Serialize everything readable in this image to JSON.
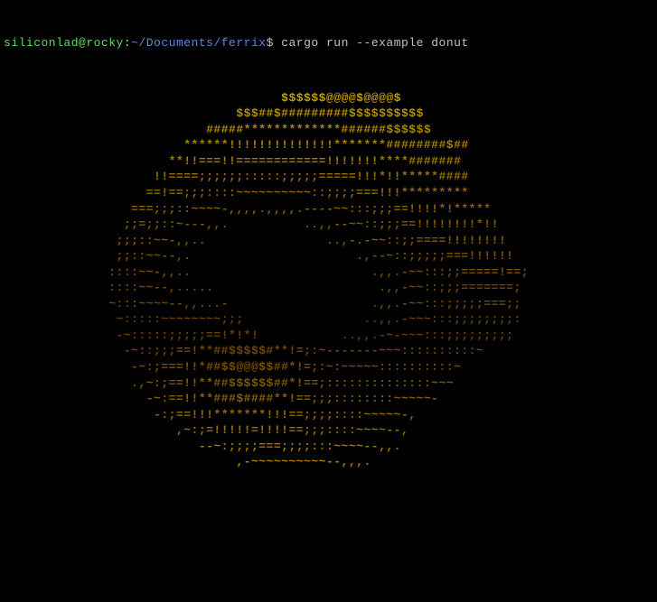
{
  "prompt": {
    "user_host": "siliconlad@rocky",
    "separator": ":",
    "path": "~/Documents/ferrix",
    "sigil": "$",
    "command": "cargo run --example donut"
  },
  "donut": {
    "lines": [
      "                                     $$$$$$@@@@$@@@@$",
      "                               $$$##$#########$$$$$$$$$$",
      "                           #####*************######$$$$$$",
      "                        ******!!!!!!!!!!!!!!*******########$##",
      "                      **!!===!!============!!!!!!!****#######",
      "                    !!====;;;;;;:::::;;;;;=====!!!*!!*****####",
      "                   ==!==;;;::::~~~~~~~~~~::;;;;===!!!*********",
      "                 ===;;;::~~~~-,,,,.,,,,.----~~:::;;;==!!!!*!*****",
      "                ;;=;;::~---,,.          ..,,--~~::;;;==!!!!!!!!*!!",
      "               ;;;::~~-,,..                ..,-.-~~::;;====!!!!!!!!",
      "               ;;::~~--,.                      .,--~::;;;;;===!!!!!!",
      "              ::::~~-,,..                        .,,.-~~:::;;=====!==;",
      "              ::::~~--,.....                      .,,-~~::;;;=======;",
      "              ~:::~~~~--,,...-                   .,,.-~~:::;;;;;===;;",
      "               ~:::::~~~~~~~~;;;                ..,,.-~~~:::;;;;;;;;:",
      "               -~:::::;;;;;==!*!*!           ..,,.-~-~~~:::;;;;;;;;;",
      "                -~::;;;==!**##$$$$$#**!=;:~-------~~~::::::::::~",
      "                 -~:;===!!*##$$@@@$$##*!=;:~:~~~~~::::::::::~",
      "                 .,~:;==!!**##$$$$$$##*!==;::::::::::::::~~~",
      "                   -~:==!!**###$####**!==;;;::::::::~~~~~-",
      "                    -:;==!!!*******!!!==;;;;::::~~~~~-,",
      "                       ,~:;=!!!!!=!!!!==;;;::::~~~~--,",
      "                          --~:;;;;===;;;;:::~~~~--,,.",
      "                               ,-~~~~~~~~~~--,,,."
    ],
    "colors": [
      "#c0a000",
      "#b89000",
      "#b08800",
      "#a88000",
      "#a07800",
      "#987000",
      "#906800",
      "#886000",
      "#805800",
      "#805800",
      "#785000",
      "#785000",
      "#704800",
      "#704800",
      "#684000",
      "#684000",
      "#704800",
      "#785000",
      "#805800",
      "#886000",
      "#906800",
      "#987000",
      "#a07800",
      "#a88000"
    ]
  }
}
